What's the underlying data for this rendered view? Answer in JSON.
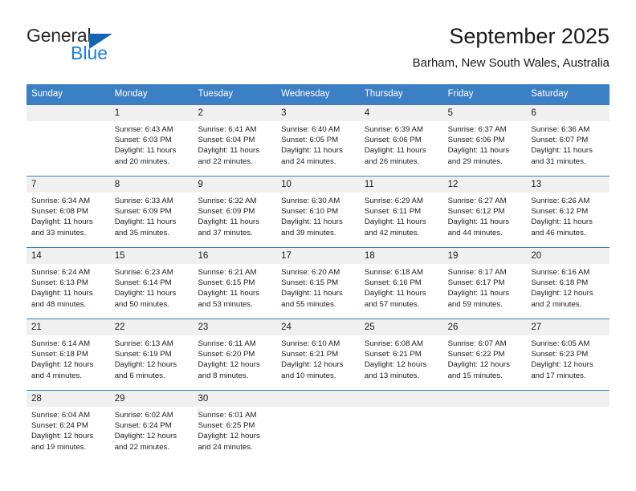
{
  "brand": {
    "name_top": "General",
    "name_bottom": "Blue",
    "triangle_color": "#1565b5",
    "blue_text_color": "#1d7fd6"
  },
  "header": {
    "title": "September 2025",
    "subtitle": "Barham, New South Wales, Australia",
    "header_bg": "#3b7fc4"
  },
  "weekdays": [
    "Sunday",
    "Monday",
    "Tuesday",
    "Wednesday",
    "Thursday",
    "Friday",
    "Saturday"
  ],
  "weeks": [
    {
      "numbers": [
        "",
        "1",
        "2",
        "3",
        "4",
        "5",
        "6"
      ],
      "cells": [
        {
          "sunrise": "",
          "sunset": "",
          "daylight": ""
        },
        {
          "sunrise": "Sunrise: 6:43 AM",
          "sunset": "Sunset: 6:03 PM",
          "daylight": "Daylight: 11 hours and 20 minutes."
        },
        {
          "sunrise": "Sunrise: 6:41 AM",
          "sunset": "Sunset: 6:04 PM",
          "daylight": "Daylight: 11 hours and 22 minutes."
        },
        {
          "sunrise": "Sunrise: 6:40 AM",
          "sunset": "Sunset: 6:05 PM",
          "daylight": "Daylight: 11 hours and 24 minutes."
        },
        {
          "sunrise": "Sunrise: 6:39 AM",
          "sunset": "Sunset: 6:06 PM",
          "daylight": "Daylight: 11 hours and 26 minutes."
        },
        {
          "sunrise": "Sunrise: 6:37 AM",
          "sunset": "Sunset: 6:06 PM",
          "daylight": "Daylight: 11 hours and 29 minutes."
        },
        {
          "sunrise": "Sunrise: 6:36 AM",
          "sunset": "Sunset: 6:07 PM",
          "daylight": "Daylight: 11 hours and 31 minutes."
        }
      ]
    },
    {
      "numbers": [
        "7",
        "8",
        "9",
        "10",
        "11",
        "12",
        "13"
      ],
      "cells": [
        {
          "sunrise": "Sunrise: 6:34 AM",
          "sunset": "Sunset: 6:08 PM",
          "daylight": "Daylight: 11 hours and 33 minutes."
        },
        {
          "sunrise": "Sunrise: 6:33 AM",
          "sunset": "Sunset: 6:09 PM",
          "daylight": "Daylight: 11 hours and 35 minutes."
        },
        {
          "sunrise": "Sunrise: 6:32 AM",
          "sunset": "Sunset: 6:09 PM",
          "daylight": "Daylight: 11 hours and 37 minutes."
        },
        {
          "sunrise": "Sunrise: 6:30 AM",
          "sunset": "Sunset: 6:10 PM",
          "daylight": "Daylight: 11 hours and 39 minutes."
        },
        {
          "sunrise": "Sunrise: 6:29 AM",
          "sunset": "Sunset: 6:11 PM",
          "daylight": "Daylight: 11 hours and 42 minutes."
        },
        {
          "sunrise": "Sunrise: 6:27 AM",
          "sunset": "Sunset: 6:12 PM",
          "daylight": "Daylight: 11 hours and 44 minutes."
        },
        {
          "sunrise": "Sunrise: 6:26 AM",
          "sunset": "Sunset: 6:12 PM",
          "daylight": "Daylight: 11 hours and 46 minutes."
        }
      ]
    },
    {
      "numbers": [
        "14",
        "15",
        "16",
        "17",
        "18",
        "19",
        "20"
      ],
      "cells": [
        {
          "sunrise": "Sunrise: 6:24 AM",
          "sunset": "Sunset: 6:13 PM",
          "daylight": "Daylight: 11 hours and 48 minutes."
        },
        {
          "sunrise": "Sunrise: 6:23 AM",
          "sunset": "Sunset: 6:14 PM",
          "daylight": "Daylight: 11 hours and 50 minutes."
        },
        {
          "sunrise": "Sunrise: 6:21 AM",
          "sunset": "Sunset: 6:15 PM",
          "daylight": "Daylight: 11 hours and 53 minutes."
        },
        {
          "sunrise": "Sunrise: 6:20 AM",
          "sunset": "Sunset: 6:15 PM",
          "daylight": "Daylight: 11 hours and 55 minutes."
        },
        {
          "sunrise": "Sunrise: 6:18 AM",
          "sunset": "Sunset: 6:16 PM",
          "daylight": "Daylight: 11 hours and 57 minutes."
        },
        {
          "sunrise": "Sunrise: 6:17 AM",
          "sunset": "Sunset: 6:17 PM",
          "daylight": "Daylight: 11 hours and 59 minutes."
        },
        {
          "sunrise": "Sunrise: 6:16 AM",
          "sunset": "Sunset: 6:18 PM",
          "daylight": "Daylight: 12 hours and 2 minutes."
        }
      ]
    },
    {
      "numbers": [
        "21",
        "22",
        "23",
        "24",
        "25",
        "26",
        "27"
      ],
      "cells": [
        {
          "sunrise": "Sunrise: 6:14 AM",
          "sunset": "Sunset: 6:18 PM",
          "daylight": "Daylight: 12 hours and 4 minutes."
        },
        {
          "sunrise": "Sunrise: 6:13 AM",
          "sunset": "Sunset: 6:19 PM",
          "daylight": "Daylight: 12 hours and 6 minutes."
        },
        {
          "sunrise": "Sunrise: 6:11 AM",
          "sunset": "Sunset: 6:20 PM",
          "daylight": "Daylight: 12 hours and 8 minutes."
        },
        {
          "sunrise": "Sunrise: 6:10 AM",
          "sunset": "Sunset: 6:21 PM",
          "daylight": "Daylight: 12 hours and 10 minutes."
        },
        {
          "sunrise": "Sunrise: 6:08 AM",
          "sunset": "Sunset: 6:21 PM",
          "daylight": "Daylight: 12 hours and 13 minutes."
        },
        {
          "sunrise": "Sunrise: 6:07 AM",
          "sunset": "Sunset: 6:22 PM",
          "daylight": "Daylight: 12 hours and 15 minutes."
        },
        {
          "sunrise": "Sunrise: 6:05 AM",
          "sunset": "Sunset: 6:23 PM",
          "daylight": "Daylight: 12 hours and 17 minutes."
        }
      ]
    },
    {
      "numbers": [
        "28",
        "29",
        "30",
        "",
        "",
        "",
        ""
      ],
      "cells": [
        {
          "sunrise": "Sunrise: 6:04 AM",
          "sunset": "Sunset: 6:24 PM",
          "daylight": "Daylight: 12 hours and 19 minutes."
        },
        {
          "sunrise": "Sunrise: 6:02 AM",
          "sunset": "Sunset: 6:24 PM",
          "daylight": "Daylight: 12 hours and 22 minutes."
        },
        {
          "sunrise": "Sunrise: 6:01 AM",
          "sunset": "Sunset: 6:25 PM",
          "daylight": "Daylight: 12 hours and 24 minutes."
        },
        {
          "sunrise": "",
          "sunset": "",
          "daylight": ""
        },
        {
          "sunrise": "",
          "sunset": "",
          "daylight": ""
        },
        {
          "sunrise": "",
          "sunset": "",
          "daylight": ""
        },
        {
          "sunrise": "",
          "sunset": "",
          "daylight": ""
        }
      ]
    }
  ]
}
